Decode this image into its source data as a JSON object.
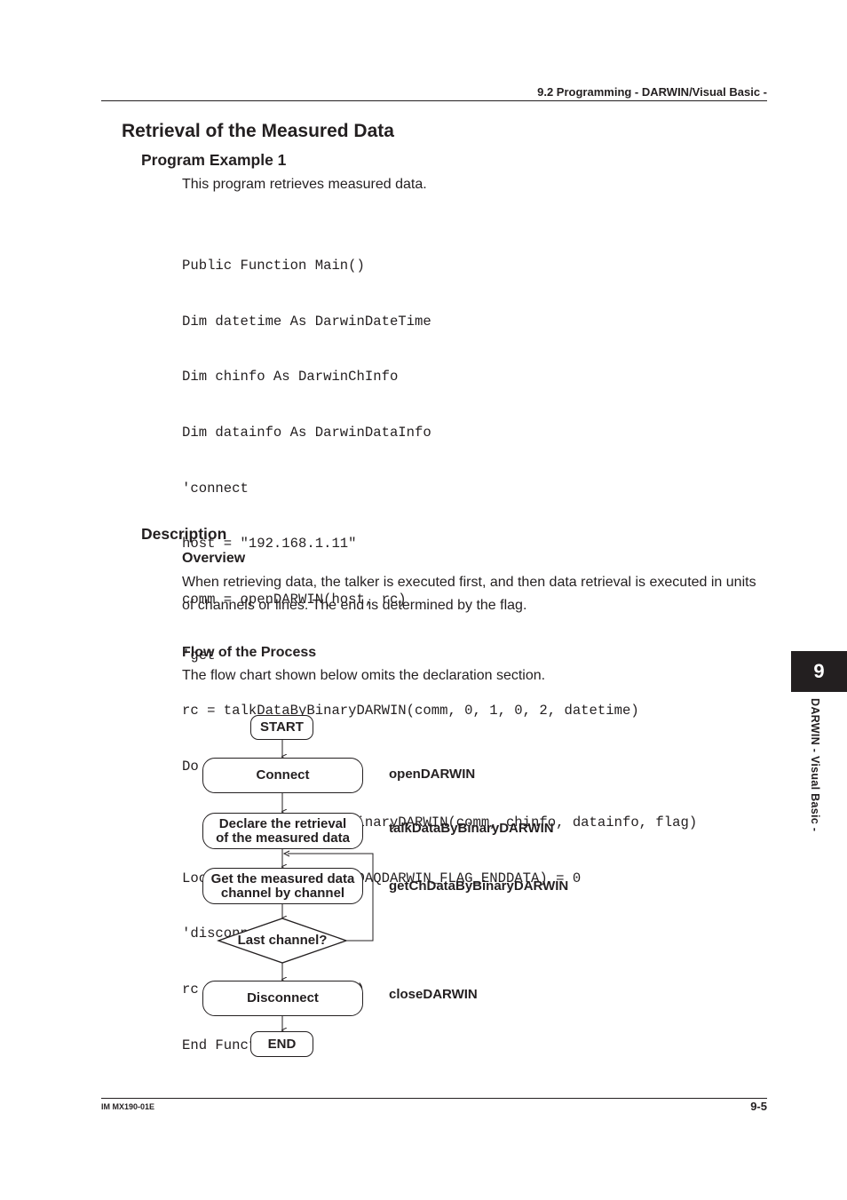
{
  "header": {
    "section": "9.2  Programming - DARWIN/Visual Basic -"
  },
  "title": "Retrieval of the Measured Data",
  "program_example": {
    "heading": "Program Example 1",
    "intro": "This program retrieves measured data.",
    "code_lines": [
      "Public Function Main()",
      "Dim datetime As DarwinDateTime",
      "Dim chinfo As DarwinChInfo",
      "Dim datainfo As DarwinDataInfo",
      "'connect",
      "host = \"192.168.1.11\"",
      "comm = openDARWIN(host, rc)",
      "'get",
      "rc = talkDataByBinaryDARWIN(comm, 0, 1, 0, 2, datetime)",
      "Do",
      "    rc = getChDataByBinaryDARWIN(comm, chinfo, datainfo, flag)",
      "Loop While (flag And DAQDARWIN_FLAG_ENDDATA) = 0",
      "'disconnect",
      "rc = closeDARWIN(comm)",
      "End Function"
    ]
  },
  "description": {
    "heading": "Description",
    "overview": {
      "heading": "Overview",
      "text": "When retrieving data, the talker is executed first, and then data retrieval is executed in units of channels or lines. The end is determined by the flag."
    },
    "flow": {
      "heading": "Flow of the Process",
      "text": "The flow chart shown below omits the declaration section."
    }
  },
  "flowchart": {
    "start": "START",
    "connect": "Connect",
    "declare_line1": "Declare the retrieval",
    "declare_line2": "of the measured data",
    "get_line1": "Get the measured data",
    "get_line2": "channel by channel",
    "decision": "Last channel?",
    "disconnect": "Disconnect",
    "end": "END",
    "functions": {
      "connect": "openDARWIN",
      "declare": "talkDataByBinaryDARWIN",
      "get": "getChDataByBinaryDARWIN",
      "disconnect": "closeDARWIN"
    }
  },
  "side_tab": {
    "number": "9",
    "label": "DARWIN - Visual Basic -"
  },
  "footer": {
    "doc_id": "IM MX190-01E",
    "page": "9-5"
  }
}
